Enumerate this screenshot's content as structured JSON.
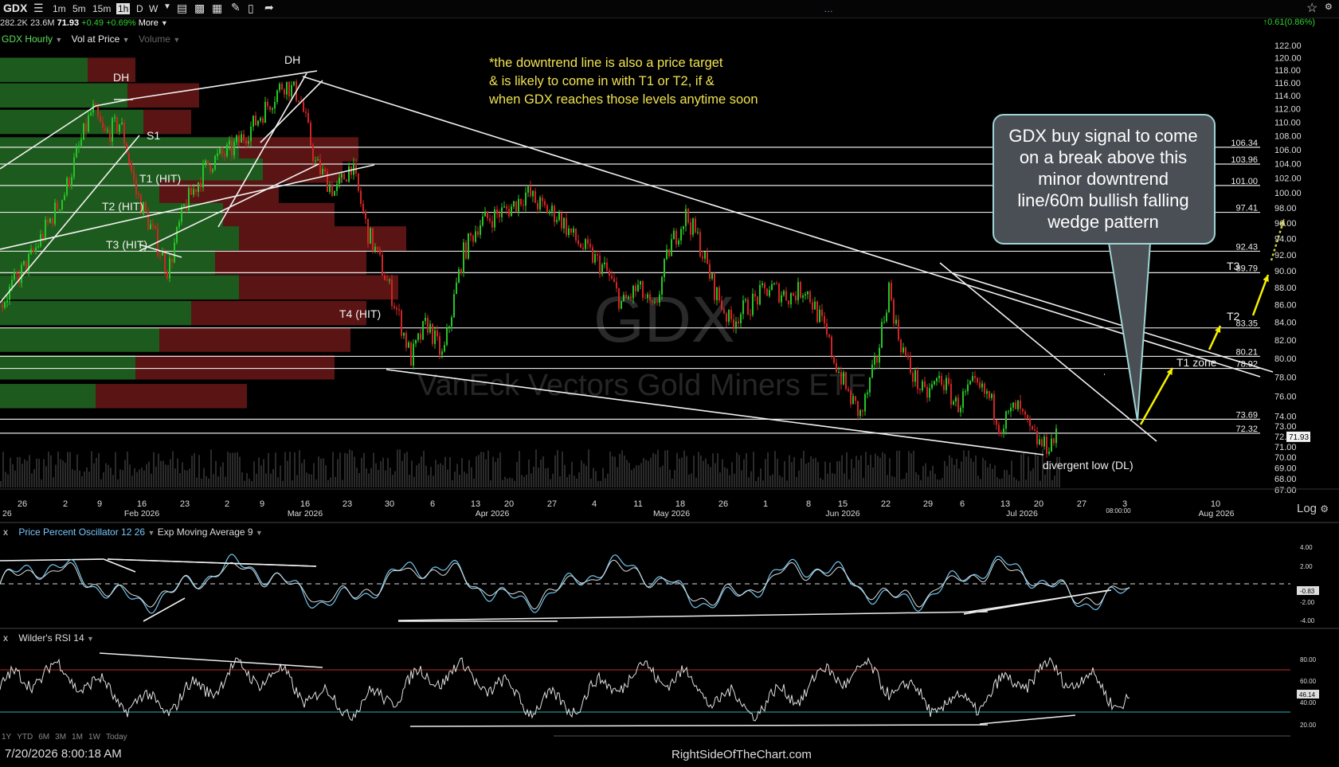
{
  "toolbar": {
    "symbol": "GDX",
    "timeframes": [
      "1m",
      "5m",
      "15m",
      "1h",
      "D",
      "W"
    ],
    "active_timeframe": "1h"
  },
  "quote": {
    "volume1": "282.2K",
    "volume2": "23.6M",
    "last": "71.93",
    "change": "+0.49",
    "change_pct": "+0.69%",
    "more": "More",
    "right_change": "0.61(0.86%)"
  },
  "studies": {
    "main": "GDX Hourly",
    "vap": "Vol at Price",
    "volume": "Volume"
  },
  "watermark": {
    "symbol": "GDX",
    "name": "VanEck Vectors Gold Miners ETF"
  },
  "annotations": {
    "note_lines": [
      "*the downtrend line is also a price target",
      "& is likely to come in with T1 or T2, if &",
      "when GDX reaches those levels anytime soon"
    ],
    "callout_lines": [
      "GDX buy signal to come",
      "on a break above this",
      "minor downtrend",
      "line/60m bullish falling",
      "wedge pattern"
    ],
    "labels": [
      "DH",
      "DH",
      "S1",
      "T1 (HIT)",
      "T2 (HIT)",
      "T3 (HIT)",
      "T4 (HIT)",
      "T3",
      "T2",
      "T1 zone",
      "divergent low (DL)"
    ]
  },
  "indicators": {
    "ppo": {
      "name": "Price Percent Oscillator 12 26",
      "ema": "Exp Moving Average 9",
      "ticks": [
        "4.00",
        "2.00",
        "-2.00",
        "-4.00"
      ],
      "current": "-0.83"
    },
    "rsi": {
      "name": "Wilder's RSI 14",
      "ticks": [
        "80.00",
        "60.00",
        "40.00",
        "20.00"
      ],
      "current": "46.14"
    }
  },
  "footer": {
    "timestamp": "7/20/2026 8:00:18 AM",
    "site": "RightSideOfTheChart.com",
    "log": "Log",
    "ranges": [
      "1Y",
      "YTD",
      "6M",
      "3M",
      "1M",
      "1W",
      "Today"
    ],
    "cursor_time": "08:00:00"
  },
  "chart_data": {
    "type": "candlestick",
    "symbol": "GDX",
    "interval": "1h",
    "scale": "log",
    "ylim": [
      67,
      122
    ],
    "y_ticks": [
      67,
      68,
      69,
      70,
      71,
      72,
      73,
      74,
      76,
      78,
      80,
      82,
      84,
      86,
      88,
      90,
      92,
      94,
      96,
      98,
      100,
      102,
      104,
      106,
      108,
      110,
      112,
      114,
      116,
      118,
      120,
      122
    ],
    "y_tick_labels": [
      "67.00",
      "68.00",
      "69.00",
      "70.00",
      "71.00",
      "72.00",
      "73.00",
      "74.00",
      "76.00",
      "78.00",
      "80.00",
      "82.00",
      "84.00",
      "86.00",
      "88.00",
      "90.00",
      "92.00",
      "94.00",
      "96.00",
      "98.00",
      "100.00",
      "102.00",
      "104.00",
      "106.00",
      "108.00",
      "110.00",
      "112.00",
      "114.00",
      "116.00",
      "118.00",
      "120.00",
      "122.00"
    ],
    "x_ticks": [
      "26",
      "2",
      "9",
      "16",
      "23",
      "2",
      "9",
      "16",
      "23",
      "30",
      "6",
      "13",
      "20",
      "27",
      "4",
      "11",
      "18",
      "26",
      "1",
      "8",
      "15",
      "22",
      "29",
      "6",
      "13",
      "20",
      "27",
      "3",
      "10"
    ],
    "month_labels": [
      "26",
      "Feb 2026",
      "Mar 2026",
      "Apr 2026",
      "May 2026",
      "Jun 2026",
      "Jul 2026",
      "Aug 2026"
    ],
    "levels": [
      106.34,
      103.96,
      101.0,
      97.41,
      92.43,
      89.79,
      83.35,
      80.21,
      78.92,
      73.69,
      72.32
    ],
    "level_labels": [
      "106.34",
      "103.96",
      "101.00",
      "97.41",
      "92.43",
      "89.79",
      "83.35",
      "80.21",
      "78.92",
      "73.69",
      "72.32"
    ],
    "last_price": 71.93,
    "last_price_label": "71.93",
    "price_path": [
      [
        0,
        86
      ],
      [
        40,
        92
      ],
      [
        80,
        100
      ],
      [
        115,
        112
      ],
      [
        130,
        108
      ],
      [
        150,
        110
      ],
      [
        170,
        100
      ],
      [
        190,
        95
      ],
      [
        210,
        90
      ],
      [
        230,
        98
      ],
      [
        260,
        104
      ],
      [
        290,
        106
      ],
      [
        320,
        110
      ],
      [
        355,
        116
      ],
      [
        375,
        114
      ],
      [
        395,
        104
      ],
      [
        420,
        100
      ],
      [
        440,
        104
      ],
      [
        460,
        95
      ],
      [
        480,
        90
      ],
      [
        495,
        86
      ],
      [
        515,
        80
      ],
      [
        535,
        84
      ],
      [
        555,
        80
      ],
      [
        580,
        92
      ],
      [
        600,
        96
      ],
      [
        620,
        97
      ],
      [
        640,
        98
      ],
      [
        660,
        100
      ],
      [
        680,
        98
      ],
      [
        700,
        97
      ],
      [
        720,
        94
      ],
      [
        740,
        92
      ],
      [
        760,
        90
      ],
      [
        780,
        86
      ],
      [
        800,
        88
      ],
      [
        820,
        85
      ],
      [
        840,
        93
      ],
      [
        860,
        97
      ],
      [
        875,
        94
      ],
      [
        895,
        88
      ],
      [
        915,
        84
      ],
      [
        940,
        86
      ],
      [
        965,
        88
      ],
      [
        990,
        87
      ],
      [
        1010,
        88
      ],
      [
        1030,
        84
      ],
      [
        1050,
        79
      ],
      [
        1065,
        76
      ],
      [
        1080,
        74
      ],
      [
        1100,
        80
      ],
      [
        1115,
        88
      ],
      [
        1125,
        83
      ],
      [
        1140,
        79
      ],
      [
        1160,
        76
      ],
      [
        1180,
        78
      ],
      [
        1200,
        75
      ],
      [
        1220,
        77
      ],
      [
        1240,
        76
      ],
      [
        1255,
        73
      ],
      [
        1275,
        75
      ],
      [
        1295,
        72
      ],
      [
        1310,
        71
      ],
      [
        1325,
        71.9
      ]
    ],
    "volume_at_price": [
      {
        "price": 118,
        "up": 110,
        "down": 60
      },
      {
        "price": 114,
        "up": 160,
        "down": 90
      },
      {
        "price": 110,
        "up": 180,
        "down": 60
      },
      {
        "price": 106,
        "up": 300,
        "down": 150
      },
      {
        "price": 103,
        "up": 330,
        "down": 100
      },
      {
        "price": 100,
        "up": 200,
        "down": 150
      },
      {
        "price": 97,
        "up": 280,
        "down": 140
      },
      {
        "price": 94,
        "up": 300,
        "down": 210
      },
      {
        "price": 91,
        "up": 270,
        "down": 190
      },
      {
        "price": 88,
        "up": 300,
        "down": 200
      },
      {
        "price": 85,
        "up": 240,
        "down": 220
      },
      {
        "price": 82,
        "up": 200,
        "down": 240
      },
      {
        "price": 79,
        "up": 170,
        "down": 250
      },
      {
        "price": 76,
        "up": 120,
        "down": 190
      }
    ],
    "indicators": [
      {
        "name": "Price Percent Oscillator 12 26",
        "ylim": [
          -4,
          4
        ],
        "ticks": [
          4,
          2,
          -2,
          -4
        ],
        "last": -0.83
      },
      {
        "name": "Wilder's RSI 14",
        "ylim": [
          20,
          80
        ],
        "ticks": [
          80,
          60,
          40,
          20
        ],
        "overbought": 70,
        "oversold": 30,
        "last": 46.14
      }
    ]
  }
}
